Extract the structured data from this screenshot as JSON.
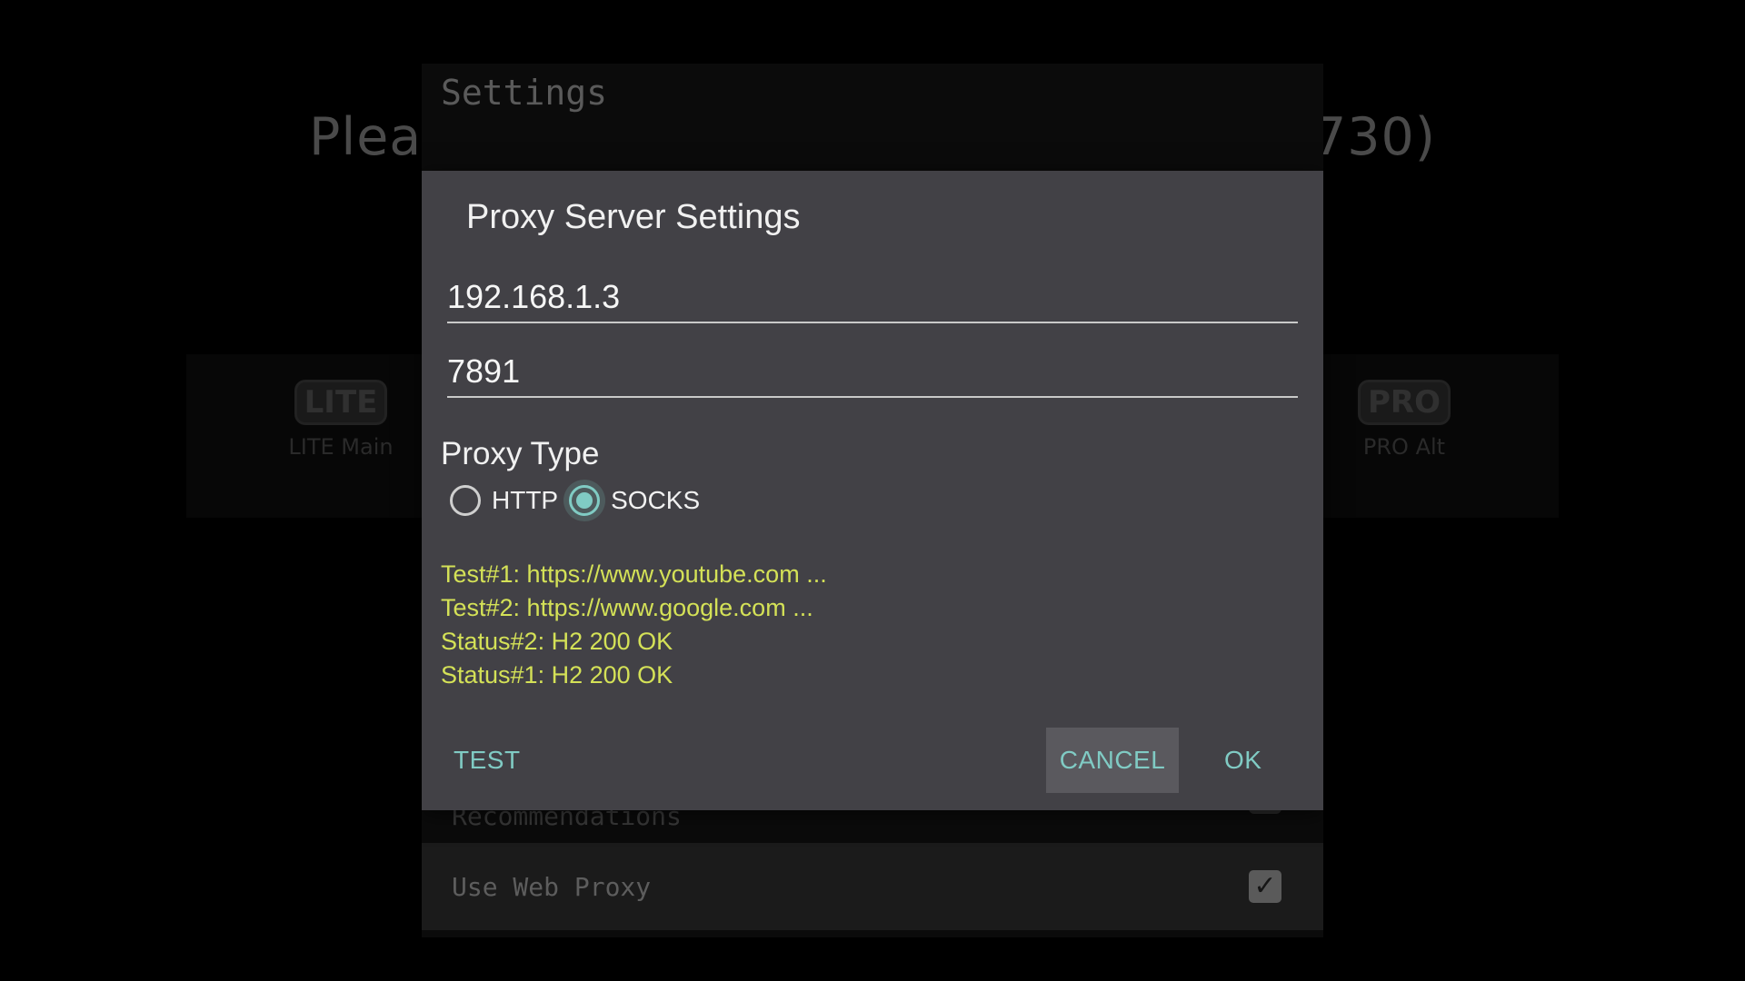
{
  "background": {
    "heading_left": "Plea",
    "heading_right": "730)",
    "settings_title": "Settings",
    "tiles": [
      {
        "icon": "LITE",
        "label": "LITE Main"
      },
      {
        "icon": "PRO",
        "label": "PRO Alt"
      }
    ],
    "recommendations_label": "Recommendations",
    "use_web_proxy_label": "Use Web Proxy",
    "use_web_proxy_checked": true
  },
  "dialog": {
    "title": "Proxy Server Settings",
    "host": "192.168.1.3",
    "port": "7891",
    "proxy_type_label": "Proxy Type",
    "proxy_types": [
      {
        "label": "HTTP",
        "selected": false
      },
      {
        "label": "SOCKS",
        "selected": true
      }
    ],
    "test_log": [
      "Test#1: https://www.youtube.com ...",
      "Test#2: https://www.google.com ...",
      "Status#2: H2 200 OK",
      "Status#1: H2 200 OK"
    ],
    "buttons": {
      "test": "TEST",
      "cancel": "CANCEL",
      "ok": "OK"
    }
  },
  "colors": {
    "accent": "#80cbc4",
    "log_text": "#d4e157",
    "dialog_bg": "#424146"
  }
}
